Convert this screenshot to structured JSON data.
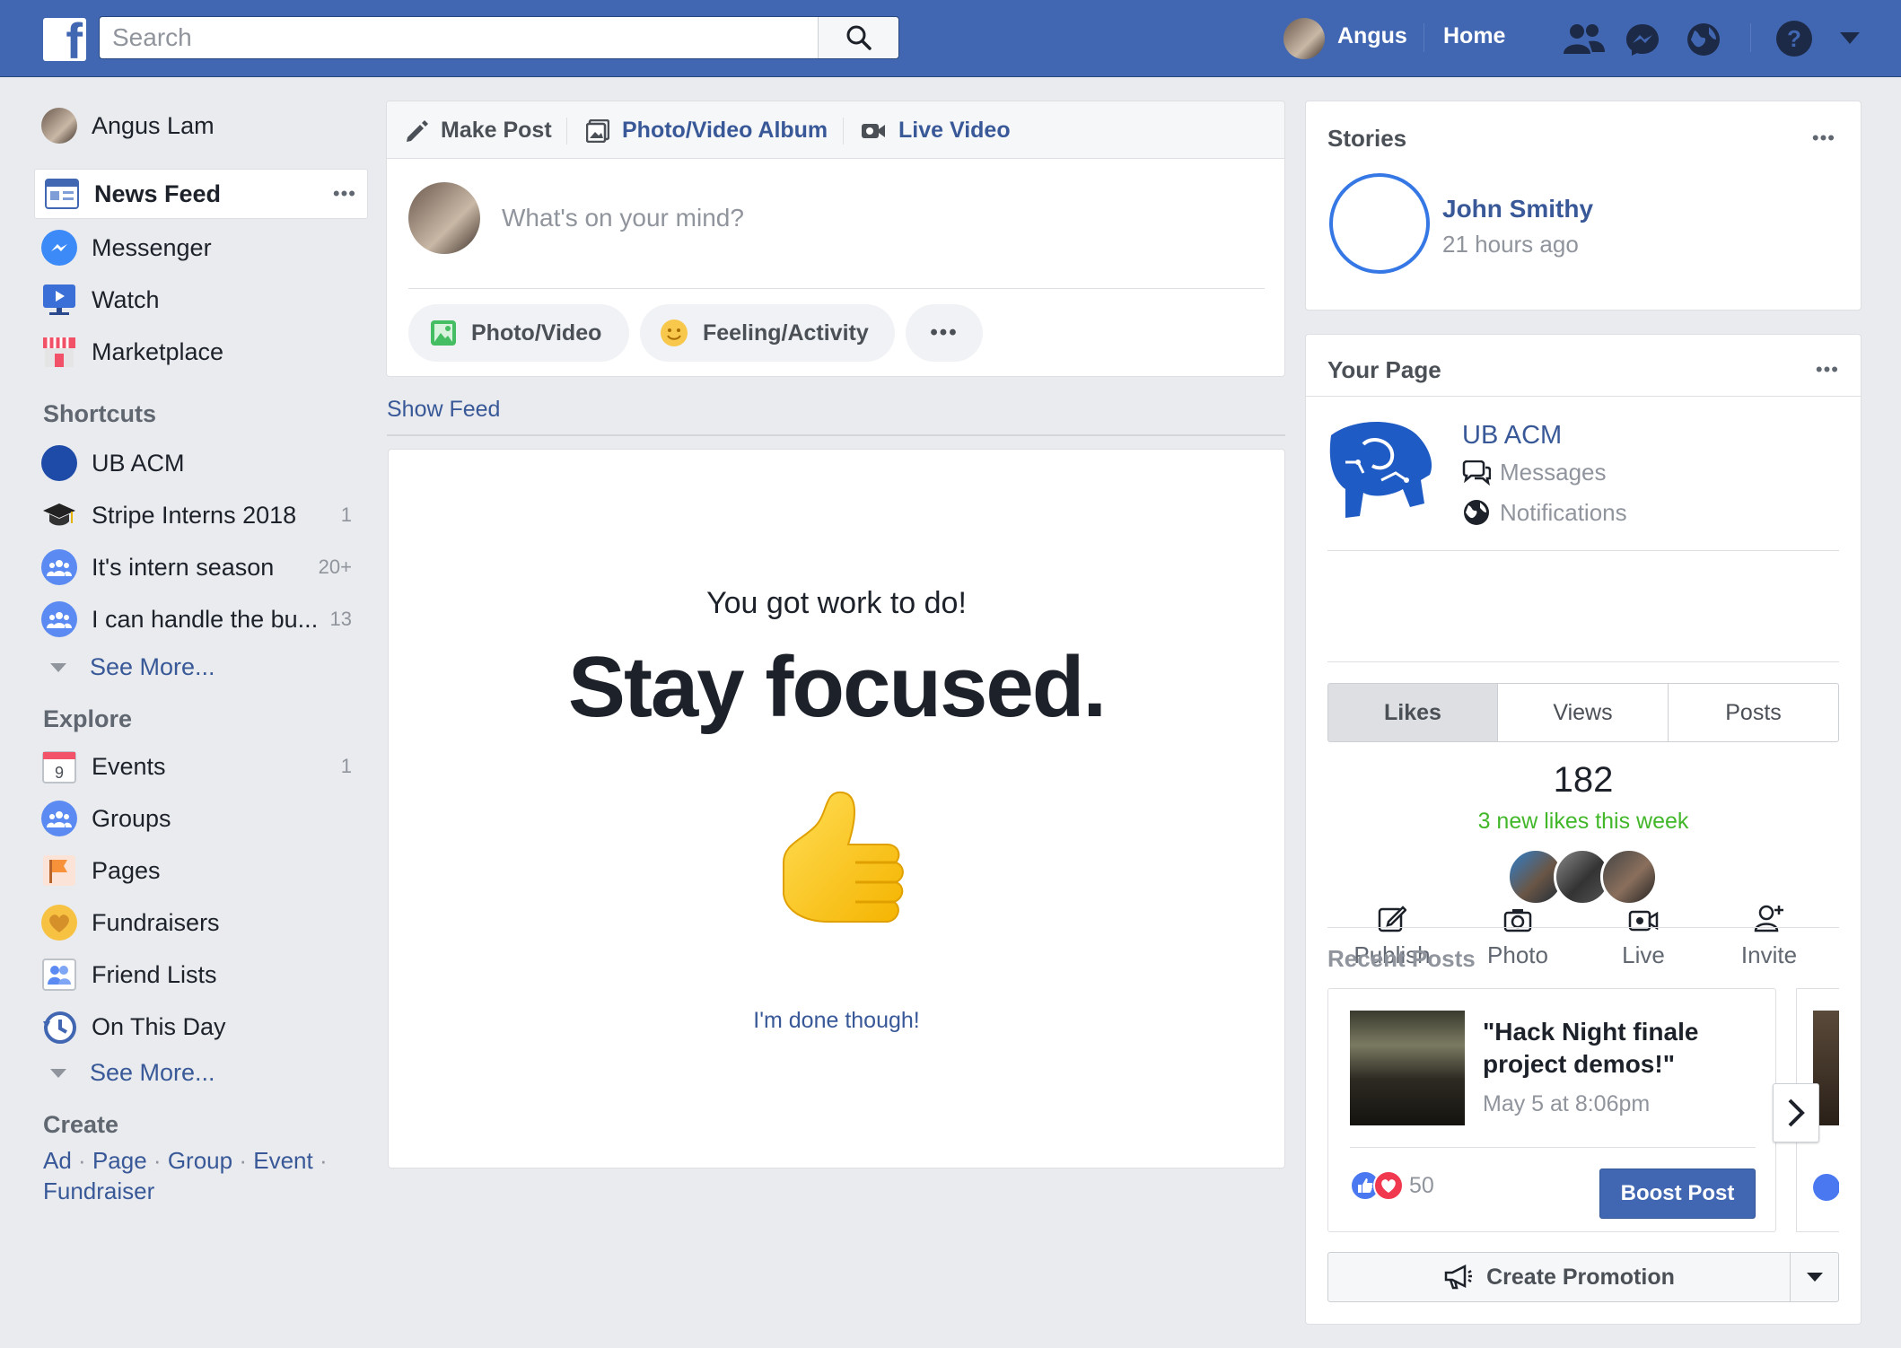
{
  "topbar": {
    "logo_letter": "f",
    "search_placeholder": "Search",
    "user_name": "Angus",
    "home_label": "Home",
    "icons": [
      "friends-icon",
      "messenger-icon",
      "globe-icon",
      "help-icon",
      "dropdown-arrow-icon"
    ]
  },
  "sidebar": {
    "profile_name": "Angus Lam",
    "main_items": [
      {
        "label": "News Feed",
        "icon": "news-feed-icon",
        "more": "•••"
      },
      {
        "label": "Messenger",
        "icon": "messenger-icon"
      },
      {
        "label": "Watch",
        "icon": "watch-icon"
      },
      {
        "label": "Marketplace",
        "icon": "marketplace-icon"
      }
    ],
    "shortcuts_heading": "Shortcuts",
    "shortcuts": [
      {
        "label": "UB ACM",
        "count": ""
      },
      {
        "label": "Stripe Interns 2018",
        "count": "1"
      },
      {
        "label": "It's intern season",
        "count": "20+"
      },
      {
        "label": "I can handle the bu...",
        "count": "13"
      }
    ],
    "see_more": "See More...",
    "explore_heading": "Explore",
    "explore": [
      {
        "label": "Events",
        "count": "1",
        "icon": "calendar-icon",
        "calendar_day": "9"
      },
      {
        "label": "Groups",
        "count": "",
        "icon": "groups-icon"
      },
      {
        "label": "Pages",
        "count": "",
        "icon": "pages-flag-icon"
      },
      {
        "label": "Fundraisers",
        "count": "",
        "icon": "fundraiser-icon"
      },
      {
        "label": "Friend Lists",
        "count": "",
        "icon": "friend-lists-icon"
      },
      {
        "label": "On This Day",
        "count": "",
        "icon": "on-this-day-icon"
      }
    ],
    "see_more_2": "See More...",
    "create_heading": "Create",
    "create_links": [
      "Ad",
      "Page",
      "Group",
      "Event",
      "Fundraiser"
    ],
    "create_sep": "·"
  },
  "composer": {
    "tabs": [
      "Make Post",
      "Photo/Video Album",
      "Live Video"
    ],
    "placeholder": "What's on your mind?",
    "actions": [
      "Photo/Video",
      "Feeling/Activity"
    ],
    "more": "•••"
  },
  "show_feed": "Show Feed",
  "focus": {
    "subtitle": "You got work to do!",
    "title": "Stay focused.",
    "emoji": "👍",
    "done_link": "I'm done though!"
  },
  "stories": {
    "heading": "Stories",
    "more": "•••",
    "name": "John Smithy",
    "time": "21 hours ago"
  },
  "your_page": {
    "heading": "Your Page",
    "more": "•••",
    "page_name": "UB ACM",
    "messages": "Messages",
    "notifications": "Notifications",
    "actions": [
      "Publish",
      "Photo",
      "Live",
      "Invite"
    ],
    "tabs": [
      "Likes",
      "Views",
      "Posts"
    ],
    "likes_count": "182",
    "likes_note": "3 new likes this week",
    "recent_heading": "Recent Posts",
    "post_title": "\"Hack Night finale project demos!\"",
    "post_date": "May 5 at 8:06pm",
    "reactions_count": "50",
    "boost_label": "Boost Post",
    "create_promotion": "Create Promotion",
    "colors": {
      "accent": "#4267b2",
      "green": "#42b72a",
      "link": "#385898"
    }
  }
}
